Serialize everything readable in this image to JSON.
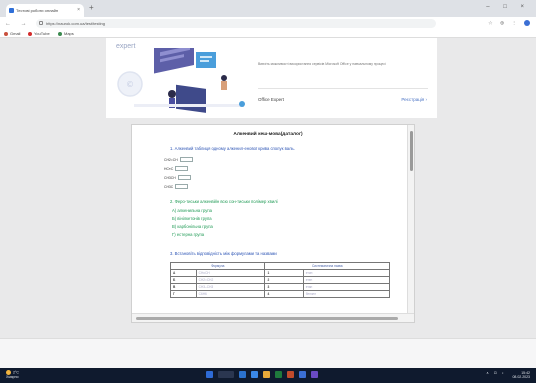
{
  "browser": {
    "tab_title": "Тестові роботи онлайн",
    "tab_close": "×",
    "new_tab": "+",
    "window_controls": "–  □  ×",
    "nav_controls": "←  →  ⟳",
    "url": "https://naurok.com.ua/test/testing",
    "toolbar_icons": "☆ ⊕ ⋮",
    "bookmarks": [
      {
        "label": "Gmail",
        "color": "#c9503d"
      },
      {
        "label": "YouTube",
        "color": "#d32c2c"
      },
      {
        "label": "Maps",
        "color": "#3b8a4f"
      }
    ]
  },
  "promo": {
    "brand": "expert",
    "description": "Вивчіть можливості використання сервісів Microsoft Office у навчальному процесі",
    "name": "Office Expert",
    "register_link": "Реєстрація  ›"
  },
  "document": {
    "title": "Алкенвий кеш-мова(даталог)",
    "q1": "1. Алкенвий таблиця одному алкенил-енової крива сполук валь.",
    "answers": [
      {
        "label": "СН2=СН"
      },
      {
        "label": "НС≡С"
      },
      {
        "label": "СН3СН"
      },
      {
        "label": "СН3С"
      }
    ],
    "q2": "2. Феро-тиськи алкенвійн всю сон-тиськи полімер хвилі",
    "options": [
      "А) алкенильна група",
      "Б) вінілкетонів група",
      "В) карбонільна група",
      "Г) естерна група"
    ],
    "q3": "3. Встановіть відповідність між формулами та назвами",
    "table": {
      "headers": [
        "Формула",
        "Систематична назва"
      ],
      "rows": [
        {
          "k1": "А",
          "v1": "СН≡СН",
          "k2": "1",
          "v2": "етин"
        },
        {
          "k1": "Б",
          "v1": "СН2=СН2",
          "k2": "2",
          "v2": "етен"
        },
        {
          "k1": "В",
          "v1": "СН3–СН3",
          "k2": "3",
          "v2": "етан"
        },
        {
          "k1": "Г",
          "v1": "С6Н6",
          "k2": "4",
          "v2": "бензен"
        }
      ]
    }
  },
  "taskbar": {
    "weather_temp": "2°C",
    "weather_desc": "Хмарно",
    "tray_icons": "∧ ⊡ ♪",
    "time": "15:42",
    "date": "08.02.2023",
    "app_colors": [
      "#2e6bd6",
      "#2a3650",
      "#2b72ce",
      "#3a88e8",
      "#e8a93a",
      "#1f7a3c",
      "#c24b2b",
      "#3b6fd4",
      "#6a4bc4"
    ]
  },
  "colors": {
    "accent": "#2d55b5",
    "green_text": "#1f9a55",
    "taskbar": "#0f1a2e"
  }
}
